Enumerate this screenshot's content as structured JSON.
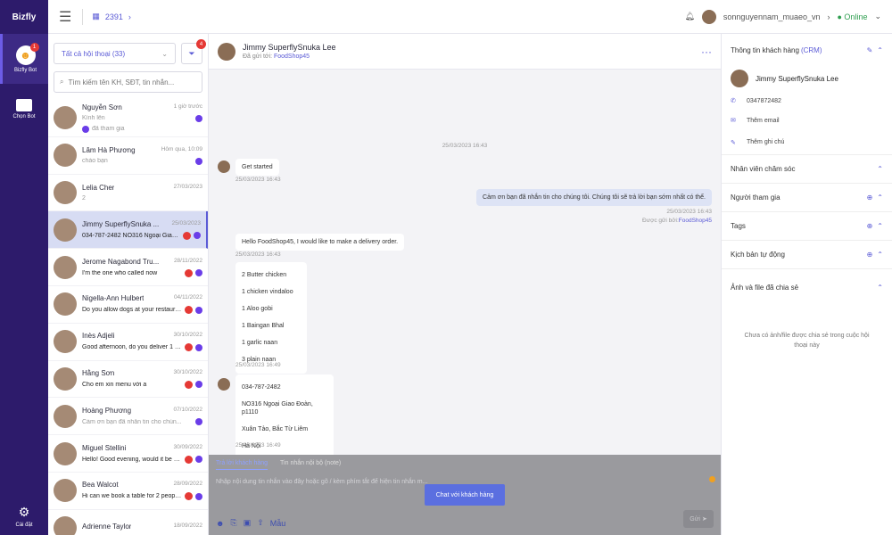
{
  "app": {
    "logo_text": "Bizfly"
  },
  "rail": {
    "items": [
      {
        "label": "Bizfly Bot",
        "badge": "1",
        "active": true
      },
      {
        "label": "Chọn Bot",
        "active": false
      }
    ],
    "bottom_label": "Cài đặt"
  },
  "topbar": {
    "org_id": "2391",
    "user_name": "sonnguyennam_muaeo_vn",
    "status": "● Online"
  },
  "list": {
    "filter_select": "Tất cả hội thoại (33)",
    "filter_badge": "4",
    "search_placeholder": "Tìm kiếm tên KH, SĐT, tin nhắn...",
    "conversations": [
      {
        "name": "Nguyễn Sơn",
        "time": "1 giờ trước",
        "preview": "Kính lên",
        "preview_style": "grey",
        "sub": "đã tham gia",
        "active": false,
        "red": false
      },
      {
        "name": "Lâm Hà Phương",
        "time": "Hôm qua, 10:09",
        "preview": "chào bạn",
        "preview_style": "grey",
        "active": false,
        "red": false
      },
      {
        "name": "Lelia Cher",
        "time": "27/03/2023",
        "preview": "2",
        "preview_style": "grey",
        "active": false,
        "red": false,
        "noicon": true
      },
      {
        "name": "Jimmy SuperflySnuka ...",
        "time": "25/03/2023",
        "preview": "034-787-2482 NO316 Ngoại Giao Đo...",
        "preview_style": "bold",
        "active": true,
        "red": true
      },
      {
        "name": "Jerome Nagabond Tru...",
        "time": "28/11/2022",
        "preview": "I'm the one who called now",
        "preview_style": "bold",
        "active": false,
        "red": true
      },
      {
        "name": "Nigella-Ann Hulbert",
        "time": "04/11/2022",
        "preview": "Do you allow dogs at your restaurant",
        "preview_style": "bold",
        "active": false,
        "red": true
      },
      {
        "name": "Inès Adjeli",
        "time": "30/10/2022",
        "preview": "Good afternoon, do you deliver 1 Or...",
        "preview_style": "bold",
        "active": false,
        "red": true
      },
      {
        "name": "Hằng Sơn",
        "time": "30/10/2022",
        "preview": "Cho em xin menu với a",
        "preview_style": "bold",
        "active": false,
        "red": true
      },
      {
        "name": "Hoàng Phương",
        "time": "07/10/2022",
        "preview": "Cảm ơn bạn đã nhắn tin cho chún...",
        "preview_style": "grey",
        "active": false,
        "red": false
      },
      {
        "name": "Miguel Stellini",
        "time": "30/09/2022",
        "preview": "Hello! Good evening, would it be po...",
        "preview_style": "bold",
        "active": false,
        "red": true
      },
      {
        "name": "Bea Walcot",
        "time": "28/09/2022",
        "preview": "Hi can we book a table for 2 people f...",
        "preview_style": "bold",
        "active": false,
        "red": true
      },
      {
        "name": "Adrienne Taylor",
        "time": "18/09/2022",
        "preview": "",
        "preview_style": "bold",
        "active": false,
        "red": false
      }
    ]
  },
  "chat": {
    "name": "Jimmy SuperflySnuka Lee",
    "sub_prefix": "Đã gửi tới:",
    "sub_page": "FoodShop45",
    "more": "···",
    "date_sep": "25/03/2023 16:43",
    "messages": {
      "m1_text": "Get started",
      "m1_time": "25/03/2023 16:43",
      "m2_text": "Cảm ơn bạn đã nhắn tin cho chúng tôi. Chúng tôi sẽ trả lời bạn sớm nhất có thể.",
      "m2_time": "25/03/2023 16:43",
      "m2_sent_prefix": "Được gửi bởi:",
      "m2_sent_by": "FoodShop45",
      "m3_text": "Hello FoodShop45, I would like to make a delivery order.",
      "m3_time": "25/03/2023 16:43",
      "m4_lines": [
        "2 Butter chicken",
        "1 chicken vindaloo",
        "1 Aloo gobi",
        "1 Baingan Bhal",
        "1 garlic naan",
        "3 plain naan"
      ],
      "m4_time": "25/03/2023 16:49",
      "m5_lines": [
        "034-787-2482",
        "NO316 Ngoại Giao Đoàn, p1110",
        "Xuân Tảo, Bắc Từ Liêm",
        "Hà Nội"
      ],
      "m5_time": "25/03/2023 16:49"
    },
    "composer": {
      "tab_active": "Trả lời khách hàng",
      "tab_other": "Tin nhắn nội bộ (note)",
      "placeholder": "Nhập nội dung tin nhắn vào đây hoặc gõ / kèm phím tắt để hiện tin nhắn m...",
      "cta": "Chat với khách hàng",
      "send": "Gửi ➤",
      "tool_label": "Mẫu"
    }
  },
  "info": {
    "title": "Thông tin khách hàng",
    "crm_tag": "(CRM)",
    "customer_name": "Jimmy SuperflySnuka Lee",
    "phone": "0347872482",
    "email": "Thêm email",
    "note": "Thêm ghi chú",
    "sections": [
      "Nhân viên chăm sóc",
      "Người tham gia",
      "Tags",
      "Kịch bản tự động",
      "Ảnh và file đã chia sẻ"
    ],
    "empty_text": "Chưa có ảnh/file được chia sẻ trong cuộc hội thoại này"
  }
}
